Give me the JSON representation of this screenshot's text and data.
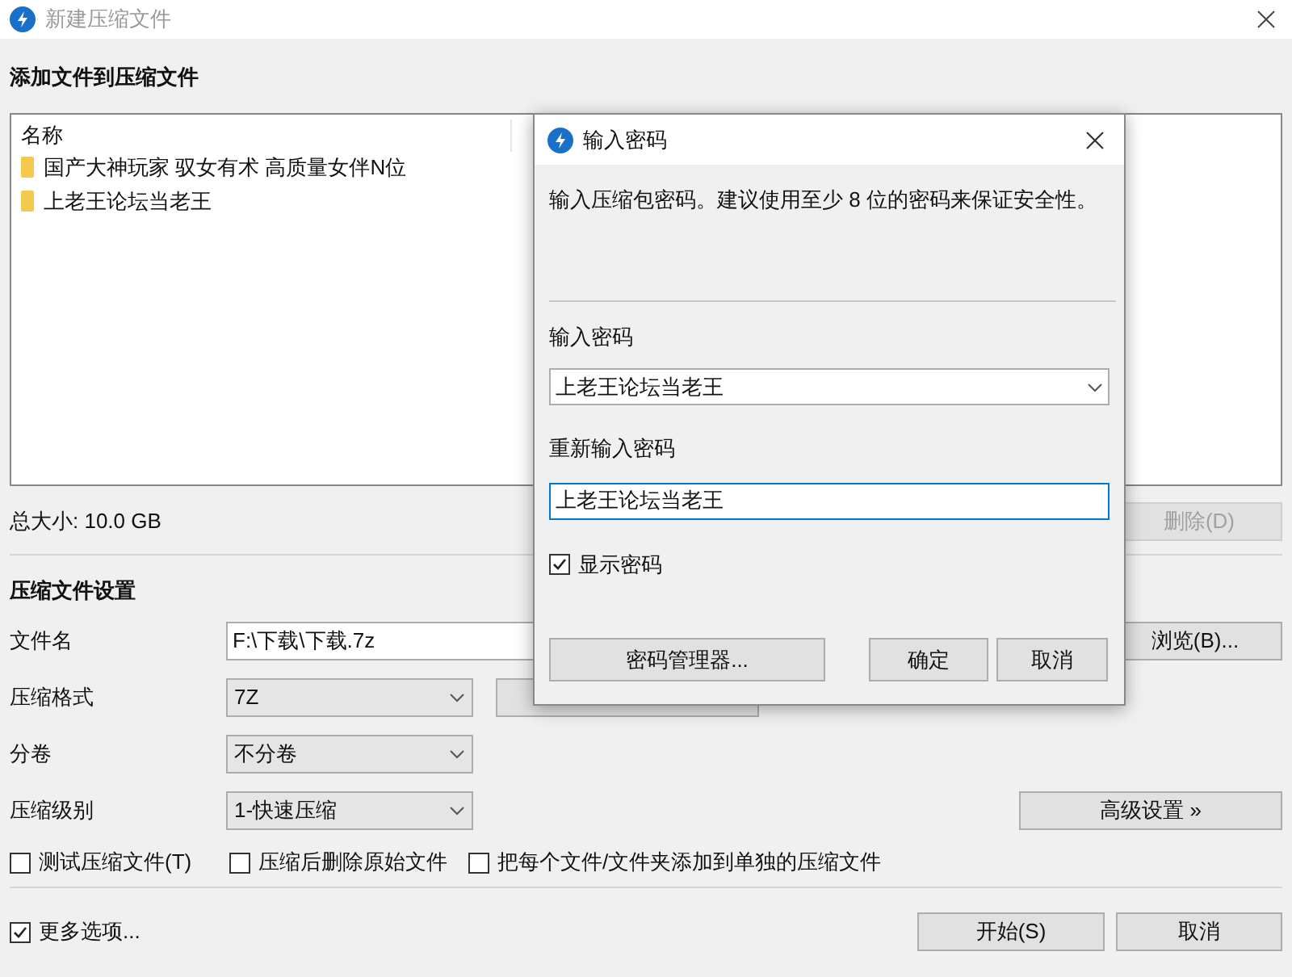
{
  "window": {
    "title": "新建压缩文件"
  },
  "add_section": {
    "heading": "添加文件到压缩文件",
    "columns": [
      "名称"
    ],
    "rows": [
      {
        "name": "国产大神玩家 驭女有术 高质量女伴N位"
      },
      {
        "name": "上老王论坛当老王"
      }
    ],
    "total_size": "总大小: 10.0 GB",
    "delete_button": {
      "label": "删除(D)",
      "disabled": true
    }
  },
  "settings": {
    "heading": "压缩文件设置",
    "filename": {
      "label": "文件名",
      "value": "F:\\下载\\下载.7z"
    },
    "browse_button": "浏览(B)...",
    "format": {
      "label": "压缩格式",
      "value": "7Z"
    },
    "volume": {
      "label": "分卷",
      "value": "不分卷"
    },
    "level": {
      "label": "压缩级别",
      "value": "1-快速压缩"
    },
    "advanced_button": "高级设置 »",
    "options": [
      {
        "label": "测试压缩文件(T)",
        "checked": false
      },
      {
        "label": "压缩后删除原始文件",
        "checked": false
      },
      {
        "label": "把每个文件/文件夹添加到单独的压缩文件",
        "checked": false
      }
    ]
  },
  "more_options": {
    "label": "更多选项...",
    "checked": true
  },
  "buttons": [
    "开始(S)",
    "取消"
  ],
  "dialog": {
    "title": "输入密码",
    "description": "输入压缩包密码。建议使用至少 8 位的密码来保证安全性。",
    "password_label": "输入密码",
    "password_value": "上老王论坛当老王",
    "confirm_label": "重新输入密码",
    "confirm_value": "上老王论坛当老王",
    "show_password": {
      "label": "显示密码",
      "checked": true
    },
    "buttons": [
      "密码管理器...",
      "确定",
      "取消"
    ]
  }
}
